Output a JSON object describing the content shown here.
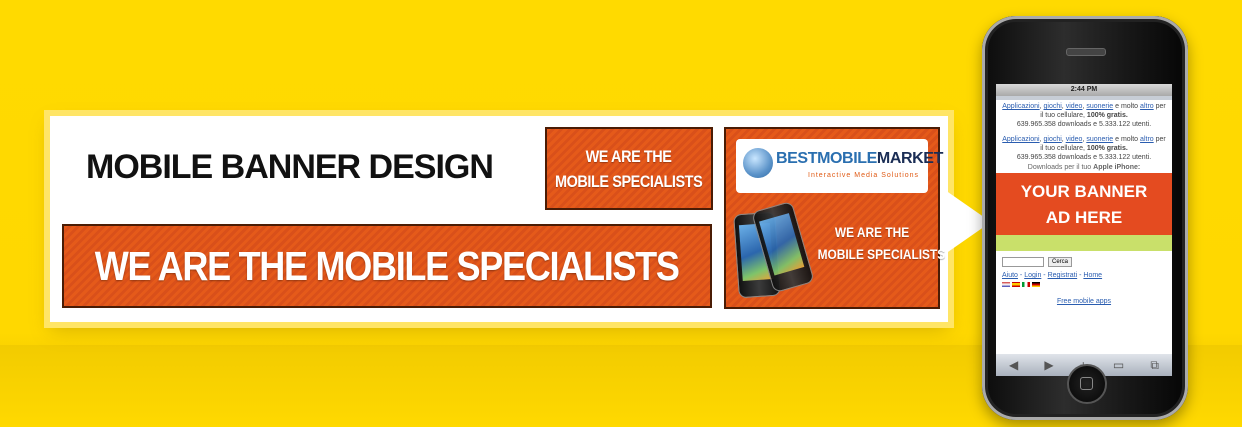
{
  "title": "MOBILE BANNER DESIGN",
  "banner_wide": "WE ARE THE MOBILE SPECIALISTS",
  "banner_small": {
    "line1": "WE ARE THE",
    "line2": "MOBILE SPECIALISTS"
  },
  "banner_box": {
    "logo_brand_part1": "BESTMOBILE",
    "logo_brand_part2": "MARKET",
    "logo_tagline": "Interactive Media Solutions",
    "line1": "WE ARE THE",
    "line2": "MOBILE SPECIALISTS"
  },
  "phone": {
    "status_time": "2:44 PM",
    "block1": {
      "links": [
        "Applicazioni",
        "giochi",
        "video",
        "suonerie"
      ],
      "text1": "e molto",
      "link_altro": "altro",
      "text2": "per il tuo cellulare,",
      "bold": "100% gratis.",
      "stats": "639.965.358 downloads e 5.333.122 utenti."
    },
    "block2": {
      "links": [
        "Applicazioni",
        "giochi",
        "video",
        "suonerie"
      ],
      "text1": "e molto",
      "link_altro": "altro",
      "text2": "per il tuo cellulare,",
      "bold": "100% gratis.",
      "stats": "639.965.358 downloads e 5.333.122 utenti."
    },
    "downloads_label": "Downloads per il tuo",
    "downloads_device": "Apple iPhone:",
    "ad_line1": "YOUR BANNER",
    "ad_line2": "AD HERE",
    "search_button": "Cerca",
    "nav_links": [
      "Aiuto",
      "Login",
      "Registrati",
      "Home"
    ],
    "free_link": "Free mobile apps",
    "toolbar_icons": [
      "back-icon",
      "forward-icon",
      "add-icon",
      "bookmarks-icon",
      "pages-icon"
    ],
    "toolbar_glyphs": [
      "◀",
      "▶",
      "+",
      "▭",
      "⧉"
    ]
  },
  "colors": {
    "background": "#ffda00",
    "banner_orange": "#e55a1a",
    "banner_border": "#4a1c05",
    "link_blue": "#2a5db0"
  }
}
